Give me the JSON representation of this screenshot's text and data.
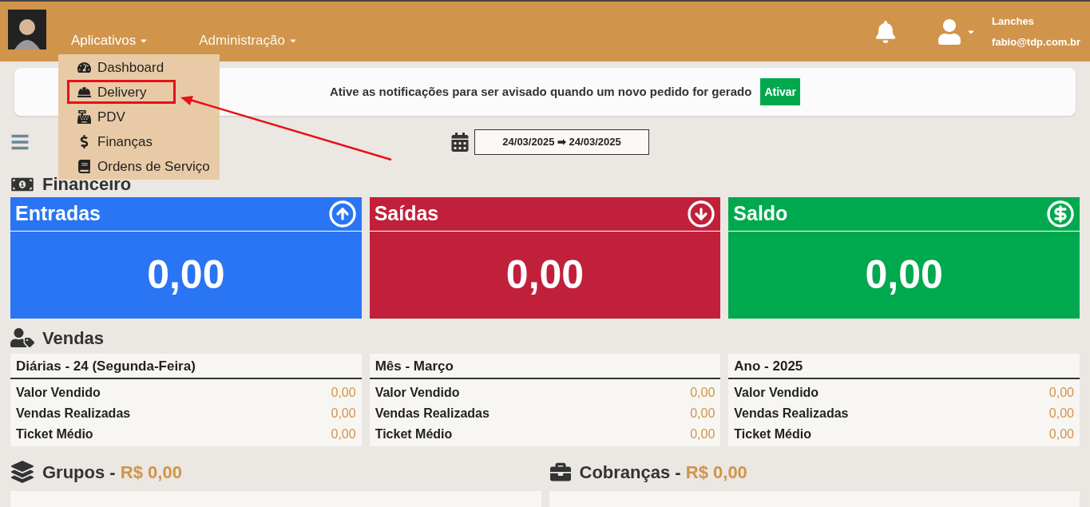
{
  "header": {
    "menus": [
      {
        "label": "Aplicativos",
        "expanded": true
      },
      {
        "label": "Administração",
        "expanded": false
      }
    ],
    "user": {
      "name": "Lanches",
      "email": "fabio@tdp.com.br"
    }
  },
  "dropdown": {
    "items": [
      {
        "label": "Dashboard",
        "highlighted": false
      },
      {
        "label": "Delivery",
        "highlighted": true
      },
      {
        "label": "PDV",
        "highlighted": false
      },
      {
        "label": "Finanças",
        "highlighted": false
      },
      {
        "label": "Ordens de Serviço",
        "highlighted": false
      }
    ]
  },
  "notification": {
    "text": "Ative as notificações para ser avisado quando um novo pedido for gerado",
    "button": "Ativar"
  },
  "date_range": "24/03/2025 ➡ 24/03/2025",
  "financeiro": {
    "title": "Financeiro",
    "cards": [
      {
        "title": "Entradas",
        "value": "0,00",
        "kind": "in"
      },
      {
        "title": "Saídas",
        "value": "0,00",
        "kind": "out"
      },
      {
        "title": "Saldo",
        "value": "0,00",
        "kind": "balance"
      }
    ]
  },
  "vendas": {
    "title": "Vendas",
    "tables": [
      {
        "title": "Diárias - 24 (Segunda-Feira)",
        "rows": [
          {
            "label": "Valor Vendido",
            "value": "0,00"
          },
          {
            "label": "Vendas Realizadas",
            "value": "0,00"
          },
          {
            "label": "Ticket Médio",
            "value": "0,00"
          }
        ]
      },
      {
        "title": "Mês - Março",
        "rows": [
          {
            "label": "Valor Vendido",
            "value": "0,00"
          },
          {
            "label": "Vendas Realizadas",
            "value": "0,00"
          },
          {
            "label": "Ticket Médio",
            "value": "0,00"
          }
        ]
      },
      {
        "title": "Ano - 2025",
        "rows": [
          {
            "label": "Valor Vendido",
            "value": "0,00"
          },
          {
            "label": "Vendas Realizadas",
            "value": "0,00"
          },
          {
            "label": "Ticket Médio",
            "value": "0,00"
          }
        ]
      }
    ]
  },
  "grupos": {
    "title": "Grupos",
    "separator": "-",
    "amount": "R$ 0,00"
  },
  "cobrancas": {
    "title": "Cobranças",
    "separator": "-",
    "amount": "R$ 0,00"
  }
}
